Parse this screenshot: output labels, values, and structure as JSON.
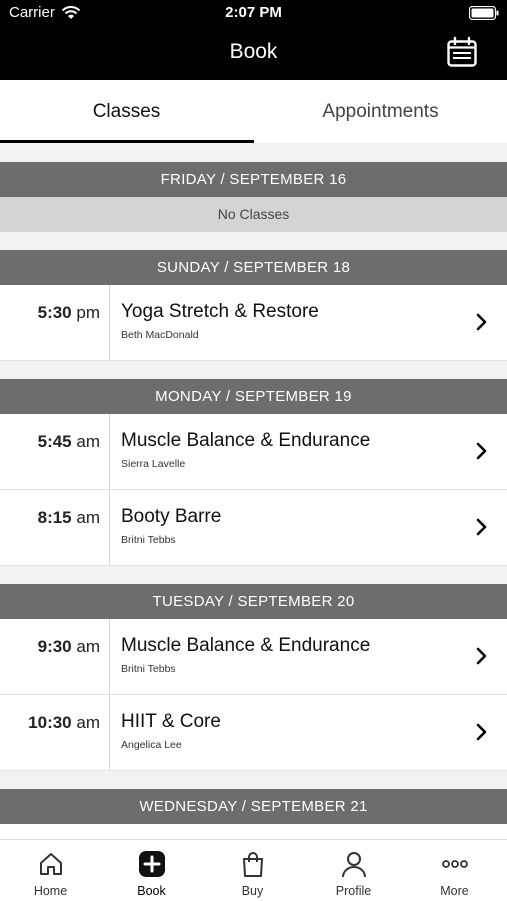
{
  "status_bar": {
    "carrier": "Carrier",
    "time": "2:07 PM"
  },
  "nav": {
    "title": "Book"
  },
  "tabs": [
    {
      "label": "Classes",
      "selected": true
    },
    {
      "label": "Appointments",
      "selected": false
    }
  ],
  "days": [
    {
      "header": "FRIDAY / SEPTEMBER 16",
      "empty_text": "No Classes",
      "classes": []
    },
    {
      "header": "SUNDAY / SEPTEMBER 18",
      "classes": [
        {
          "time": "5:30",
          "ampm": "pm",
          "title": "Yoga Stretch & Restore",
          "instructor": "Beth MacDonald"
        }
      ]
    },
    {
      "header": "MONDAY / SEPTEMBER 19",
      "classes": [
        {
          "time": "5:45",
          "ampm": "am",
          "title": "Muscle Balance & Endurance",
          "instructor": "Sierra Lavelle"
        },
        {
          "time": "8:15",
          "ampm": "am",
          "title": "Booty Barre",
          "instructor": "Britni Tebbs"
        }
      ]
    },
    {
      "header": "TUESDAY / SEPTEMBER 20",
      "classes": [
        {
          "time": "9:30",
          "ampm": "am",
          "title": "Muscle Balance & Endurance",
          "instructor": "Britni Tebbs"
        },
        {
          "time": "10:30",
          "ampm": "am",
          "title": "HIIT & Core",
          "instructor": "Angelica Lee"
        }
      ]
    },
    {
      "header": "WEDNESDAY / SEPTEMBER 21",
      "classes": []
    }
  ],
  "tabbar": [
    {
      "label": "Home",
      "icon": "home-icon"
    },
    {
      "label": "Book",
      "icon": "book-plus-icon",
      "selected": true
    },
    {
      "label": "Buy",
      "icon": "shopping-bag-icon"
    },
    {
      "label": "Profile",
      "icon": "profile-icon"
    },
    {
      "label": "More",
      "icon": "more-dots-icon"
    }
  ],
  "colors": {
    "topbar": "#000000",
    "day_header": "#6d6d6d",
    "no_classes_bg": "#d4d4d4"
  }
}
